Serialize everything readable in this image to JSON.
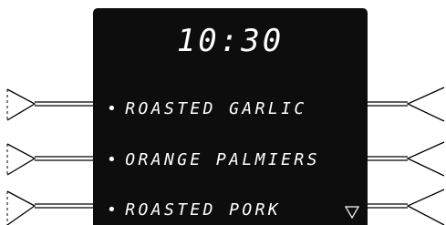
{
  "display": {
    "time": "10:30",
    "menu_items": [
      {
        "label": "ROASTED GARLIC"
      },
      {
        "label": "ORANGE PALMIERS"
      },
      {
        "label": "ROASTED PORK"
      }
    ],
    "bullet": "•",
    "scroll_indicator_icon": "triangle-down-outline-icon"
  },
  "colors": {
    "screen": "#0d0d0d",
    "text": "#ffffff",
    "button_stroke": "#000000"
  }
}
